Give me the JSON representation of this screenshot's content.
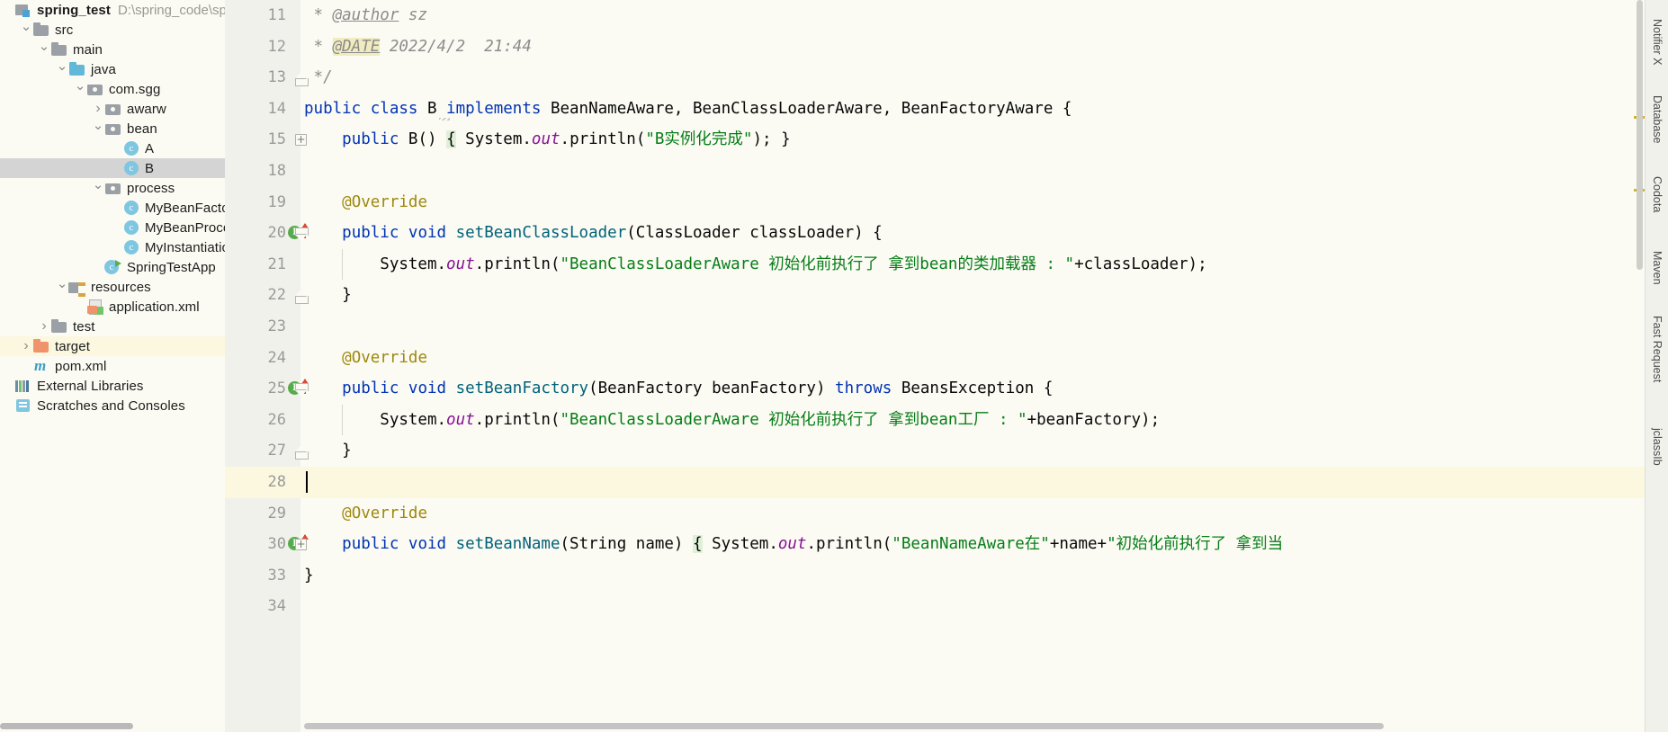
{
  "project": {
    "name": "spring_test",
    "path": "D:\\spring_code\\spring_t",
    "items": [
      {
        "label": "src",
        "indent": 1,
        "arrow": "down",
        "icon": "folder",
        "state": "normal"
      },
      {
        "label": "main",
        "indent": 2,
        "arrow": "down",
        "icon": "folder",
        "state": "normal"
      },
      {
        "label": "java",
        "indent": 3,
        "arrow": "down",
        "icon": "folder-blue",
        "state": "normal"
      },
      {
        "label": "com.sgg",
        "indent": 4,
        "arrow": "down",
        "icon": "package",
        "state": "normal"
      },
      {
        "label": "awarw",
        "indent": 5,
        "arrow": "right",
        "icon": "package",
        "state": "normal"
      },
      {
        "label": "bean",
        "indent": 5,
        "arrow": "down",
        "icon": "package",
        "state": "normal"
      },
      {
        "label": "A",
        "indent": 6,
        "arrow": "none",
        "icon": "cls",
        "state": "normal"
      },
      {
        "label": "B",
        "indent": 6,
        "arrow": "none",
        "icon": "cls",
        "state": "selected"
      },
      {
        "label": "process",
        "indent": 5,
        "arrow": "down",
        "icon": "package",
        "state": "normal"
      },
      {
        "label": "MyBeanFactoryPr",
        "indent": 6,
        "arrow": "none",
        "icon": "cls",
        "state": "normal"
      },
      {
        "label": "MyBeanProcessor",
        "indent": 6,
        "arrow": "none",
        "icon": "cls",
        "state": "normal"
      },
      {
        "label": "MyInstantiationAv",
        "indent": 6,
        "arrow": "none",
        "icon": "cls",
        "state": "normal"
      },
      {
        "label": "SpringTestApp",
        "indent": 5,
        "arrow": "none",
        "icon": "cls-run",
        "state": "normal"
      },
      {
        "label": "resources",
        "indent": 3,
        "arrow": "down",
        "icon": "resources",
        "state": "normal"
      },
      {
        "label": "application.xml",
        "indent": 4,
        "arrow": "none",
        "icon": "xml",
        "state": "normal"
      },
      {
        "label": "test",
        "indent": 2,
        "arrow": "right",
        "icon": "folder",
        "state": "normal"
      },
      {
        "label": "target",
        "indent": 1,
        "arrow": "right",
        "icon": "folder-orange",
        "state": "highlight"
      },
      {
        "label": "pom.xml",
        "indent": 1,
        "arrow": "none",
        "icon": "maven",
        "state": "normal"
      },
      {
        "label": "External Libraries",
        "indent": 0,
        "arrow": "none",
        "icon": "libs",
        "state": "normal"
      },
      {
        "label": "Scratches and Consoles",
        "indent": 0,
        "arrow": "none",
        "icon": "scratch",
        "state": "normal"
      }
    ]
  },
  "editor": {
    "lines": [
      {
        "no": "11",
        "mark": "",
        "fold": "",
        "segments": [
          {
            "t": " * ",
            "c": "cmt"
          },
          {
            "t": "@author",
            "c": "cmt-tag"
          },
          {
            "t": " sz",
            "c": "cmt"
          }
        ]
      },
      {
        "no": "12",
        "mark": "",
        "fold": "",
        "segments": [
          {
            "t": " * ",
            "c": "cmt"
          },
          {
            "t": "@DATE",
            "c": "cmt-tag-hl"
          },
          {
            "t": " 2022/4/2  21:44",
            "c": "cmt"
          }
        ]
      },
      {
        "no": "13",
        "mark": "",
        "fold": "arrowup",
        "segments": [
          {
            "t": " */",
            "c": "cmt"
          }
        ]
      },
      {
        "no": "14",
        "mark": "",
        "fold": "",
        "segments": [
          {
            "t": "public class ",
            "c": "kw"
          },
          {
            "t": "B",
            "c": "pln"
          },
          {
            "t": " implements ",
            "c": "kw"
          },
          {
            "t": "BeanNameAware, BeanClassLoaderAware, BeanFactoryAware ",
            "c": "pln"
          },
          {
            "t": "{",
            "c": "pln"
          }
        ]
      },
      {
        "no": "15",
        "mark": "",
        "fold": "square",
        "segments": [
          {
            "t": "    ",
            "c": "pln"
          },
          {
            "t": "public ",
            "c": "kw"
          },
          {
            "t": "B",
            "c": "pln"
          },
          {
            "t": "() ",
            "c": "pln"
          },
          {
            "t": "{",
            "c": "brace-hl"
          },
          {
            "t": " System.",
            "c": "pln"
          },
          {
            "t": "out",
            "c": "fld"
          },
          {
            "t": ".println(",
            "c": "pln"
          },
          {
            "t": "\"B实例化完成\"",
            "c": "str"
          },
          {
            "t": "); }",
            "c": "pln"
          }
        ]
      },
      {
        "no": "18",
        "mark": "",
        "fold": "",
        "segments": []
      },
      {
        "no": "19",
        "mark": "",
        "fold": "",
        "segments": [
          {
            "t": "    ",
            "c": "pln"
          },
          {
            "t": "@Override",
            "c": "ann"
          }
        ]
      },
      {
        "no": "20",
        "mark": "run-up",
        "fold": "arrowdown",
        "segments": [
          {
            "t": "    ",
            "c": "pln"
          },
          {
            "t": "public void ",
            "c": "kw"
          },
          {
            "t": "setBeanClassLoader",
            "c": "mth"
          },
          {
            "t": "(ClassLoader classLoader) {",
            "c": "pln"
          }
        ]
      },
      {
        "no": "21",
        "mark": "",
        "fold": "",
        "segments": [
          {
            "t": "        System.",
            "c": "pln"
          },
          {
            "t": "out",
            "c": "fld"
          },
          {
            "t": ".println(",
            "c": "pln"
          },
          {
            "t": "\"BeanClassLoaderAware 初始化前执行了 拿到bean的类加载器 : \"",
            "c": "str"
          },
          {
            "t": "+classLoader);",
            "c": "pln"
          }
        ]
      },
      {
        "no": "22",
        "mark": "",
        "fold": "arrowup",
        "segments": [
          {
            "t": "    }",
            "c": "pln"
          }
        ]
      },
      {
        "no": "23",
        "mark": "",
        "fold": "",
        "segments": []
      },
      {
        "no": "24",
        "mark": "",
        "fold": "",
        "segments": [
          {
            "t": "    ",
            "c": "pln"
          },
          {
            "t": "@Override",
            "c": "ann"
          }
        ]
      },
      {
        "no": "25",
        "mark": "run-up",
        "fold": "arrowdown",
        "segments": [
          {
            "t": "    ",
            "c": "pln"
          },
          {
            "t": "public void ",
            "c": "kw"
          },
          {
            "t": "setBeanFactory",
            "c": "mth"
          },
          {
            "t": "(BeanFactory beanFactory) ",
            "c": "pln"
          },
          {
            "t": "throws ",
            "c": "kw"
          },
          {
            "t": "BeansException {",
            "c": "pln"
          }
        ]
      },
      {
        "no": "26",
        "mark": "",
        "fold": "",
        "segments": [
          {
            "t": "        System.",
            "c": "pln"
          },
          {
            "t": "out",
            "c": "fld"
          },
          {
            "t": ".println(",
            "c": "pln"
          },
          {
            "t": "\"BeanClassLoaderAware 初始化前执行了 拿到bean工厂 : \"",
            "c": "str"
          },
          {
            "t": "+beanFactory);",
            "c": "pln"
          }
        ]
      },
      {
        "no": "27",
        "mark": "",
        "fold": "arrowup",
        "segments": [
          {
            "t": "    }",
            "c": "pln"
          }
        ]
      },
      {
        "no": "28",
        "mark": "",
        "fold": "",
        "segments": [],
        "caret": true
      },
      {
        "no": "29",
        "mark": "",
        "fold": "",
        "segments": [
          {
            "t": "    ",
            "c": "pln"
          },
          {
            "t": "@Override",
            "c": "ann"
          }
        ]
      },
      {
        "no": "30",
        "mark": "run-up",
        "fold": "square",
        "segments": [
          {
            "t": "    ",
            "c": "pln"
          },
          {
            "t": "public void ",
            "c": "kw"
          },
          {
            "t": "setBeanName",
            "c": "mth"
          },
          {
            "t": "(String name) ",
            "c": "pln"
          },
          {
            "t": "{",
            "c": "brace-hl"
          },
          {
            "t": " System.",
            "c": "pln"
          },
          {
            "t": "out",
            "c": "fld"
          },
          {
            "t": ".println(",
            "c": "pln"
          },
          {
            "t": "\"BeanNameAware在\"",
            "c": "str"
          },
          {
            "t": "+name+",
            "c": "pln"
          },
          {
            "t": "\"初始化前执行了 拿到当",
            "c": "str"
          }
        ]
      },
      {
        "no": "33",
        "mark": "",
        "fold": "",
        "segments": [
          {
            "t": "}",
            "c": "pln"
          }
        ]
      },
      {
        "no": "34",
        "mark": "",
        "fold": "",
        "segments": []
      }
    ]
  },
  "right_tool_window": {
    "tabs": [
      {
        "label": "Notifier X",
        "icon": "notifier-icon"
      },
      {
        "label": "Database",
        "icon": "database-icon"
      },
      {
        "label": "Codota",
        "icon": "codota-icon"
      },
      {
        "label": "Maven",
        "icon": "maven-icon"
      },
      {
        "label": "Fast Request",
        "icon": "fast-request-icon"
      },
      {
        "label": "jclassIb",
        "icon": "jclass-icon"
      }
    ]
  },
  "colors": {
    "keyword": "#0033b3",
    "string": "#067d17",
    "comment": "#8c8c8c",
    "annotation": "#9e880d",
    "method": "#00627a",
    "field": "#871094",
    "editor_bg": "#fbfbf3",
    "gutter_bg": "#f1f1ec",
    "caret_line": "#fbf8df",
    "selection": "#d4d4d4"
  }
}
